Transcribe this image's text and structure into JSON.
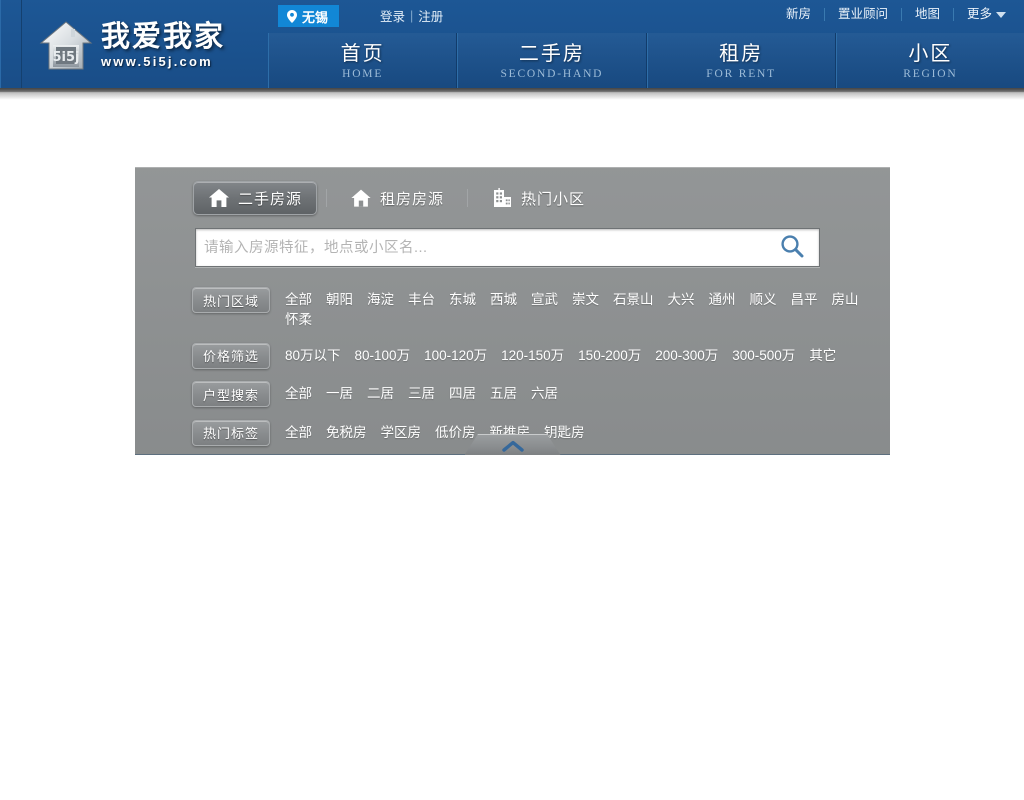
{
  "header": {
    "logo": {
      "cn": "我爱我家",
      "url": "www.5i5j.com",
      "icon": "house-logo-icon"
    },
    "city_badge": {
      "label": "无锡",
      "icon": "location-pin-icon"
    },
    "auth": {
      "login": "登录",
      "separator": "|",
      "register": "注册"
    },
    "top_links": [
      {
        "label": "新房"
      },
      {
        "label": "置业顾问"
      },
      {
        "label": "地图"
      },
      {
        "label": "更多",
        "has_caret": true,
        "caret_icon": "caret-down-icon"
      }
    ],
    "nav": [
      {
        "cn": "首页",
        "en": "HOME",
        "active": false
      },
      {
        "cn": "二手房",
        "en": "SECOND-HAND",
        "active": false
      },
      {
        "cn": "租房",
        "en": "FOR RENT",
        "active": false
      },
      {
        "cn": "小区",
        "en": "REGION",
        "active": false
      }
    ]
  },
  "panel": {
    "tabs": [
      {
        "label": "二手房源",
        "icon": "home-icon",
        "active": true
      },
      {
        "label": "租房房源",
        "icon": "home-icon",
        "active": false
      },
      {
        "label": "热门小区",
        "icon": "building-icon",
        "active": false
      }
    ],
    "search": {
      "value": "",
      "placeholder": "请输入房源特征，地点或小区名...",
      "button_icon": "search-icon"
    },
    "filters": [
      {
        "label": "热门区域",
        "options": [
          "全部",
          "朝阳",
          "海淀",
          "丰台",
          "东城",
          "西城",
          "宣武",
          "崇文",
          "石景山",
          "大兴",
          "通州",
          "顺义",
          "昌平",
          "房山",
          "怀柔"
        ]
      },
      {
        "label": "价格筛选",
        "options": [
          "80万以下",
          "80-100万",
          "100-120万",
          "120-150万",
          "150-200万",
          "200-300万",
          "300-500万",
          "其它"
        ]
      },
      {
        "label": "户型搜索",
        "options": [
          "全部",
          "一居",
          "二居",
          "三居",
          "四居",
          "五居",
          "六居"
        ]
      },
      {
        "label": "热门标签",
        "options": [
          "全部",
          "免税房",
          "学区房",
          "低价房",
          "新推房",
          "钥匙房"
        ]
      }
    ],
    "collapse": {
      "icon": "chevron-up-icon"
    }
  },
  "colors": {
    "header_blue": "#1b5390",
    "badge_blue": "#1287d6",
    "panel_gray": "#8d9091",
    "accent_blue": "#4a7fae",
    "page_bg": "#ffffff"
  }
}
